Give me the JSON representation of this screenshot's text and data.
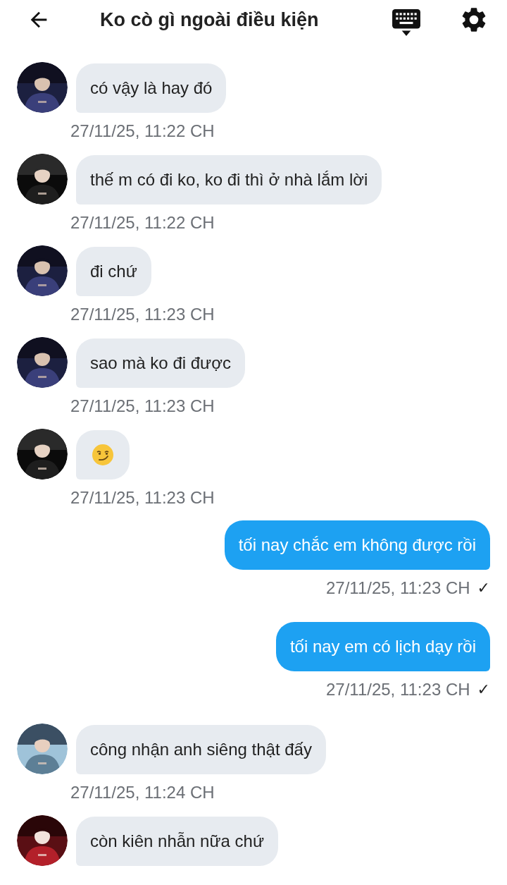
{
  "header": {
    "title": "Ko cò gì ngoài điều kiện"
  },
  "messages": [
    {
      "kind": "incoming",
      "text": "có vậy là hay đó",
      "time": "27/11/25, 11:22 CH"
    },
    {
      "kind": "incoming",
      "text": "thế m có đi ko, ko đi thì ở nhà lắm lời",
      "time": "27/11/25, 11:22 CH"
    },
    {
      "kind": "incoming",
      "text": "đi chứ",
      "time": "27/11/25, 11:23 CH"
    },
    {
      "kind": "incoming",
      "text": "sao mà ko đi được",
      "time": "27/11/25, 11:23 CH"
    },
    {
      "kind": "incoming-emoji",
      "time": "27/11/25, 11:23 CH"
    },
    {
      "kind": "outgoing",
      "text": "tối nay chắc em không được rồi",
      "time": "27/11/25, 11:23 CH",
      "tick": "✓"
    },
    {
      "kind": "outgoing",
      "text": "tối nay em có lịch dạy rồi",
      "time": "27/11/25, 11:23 CH",
      "tick": "✓"
    },
    {
      "kind": "incoming",
      "text": "công nhận anh siêng thật đấy",
      "time": "27/11/25, 11:24 CH"
    },
    {
      "kind": "incoming",
      "text": "còn kiên nhẫn nữa chứ"
    }
  ]
}
